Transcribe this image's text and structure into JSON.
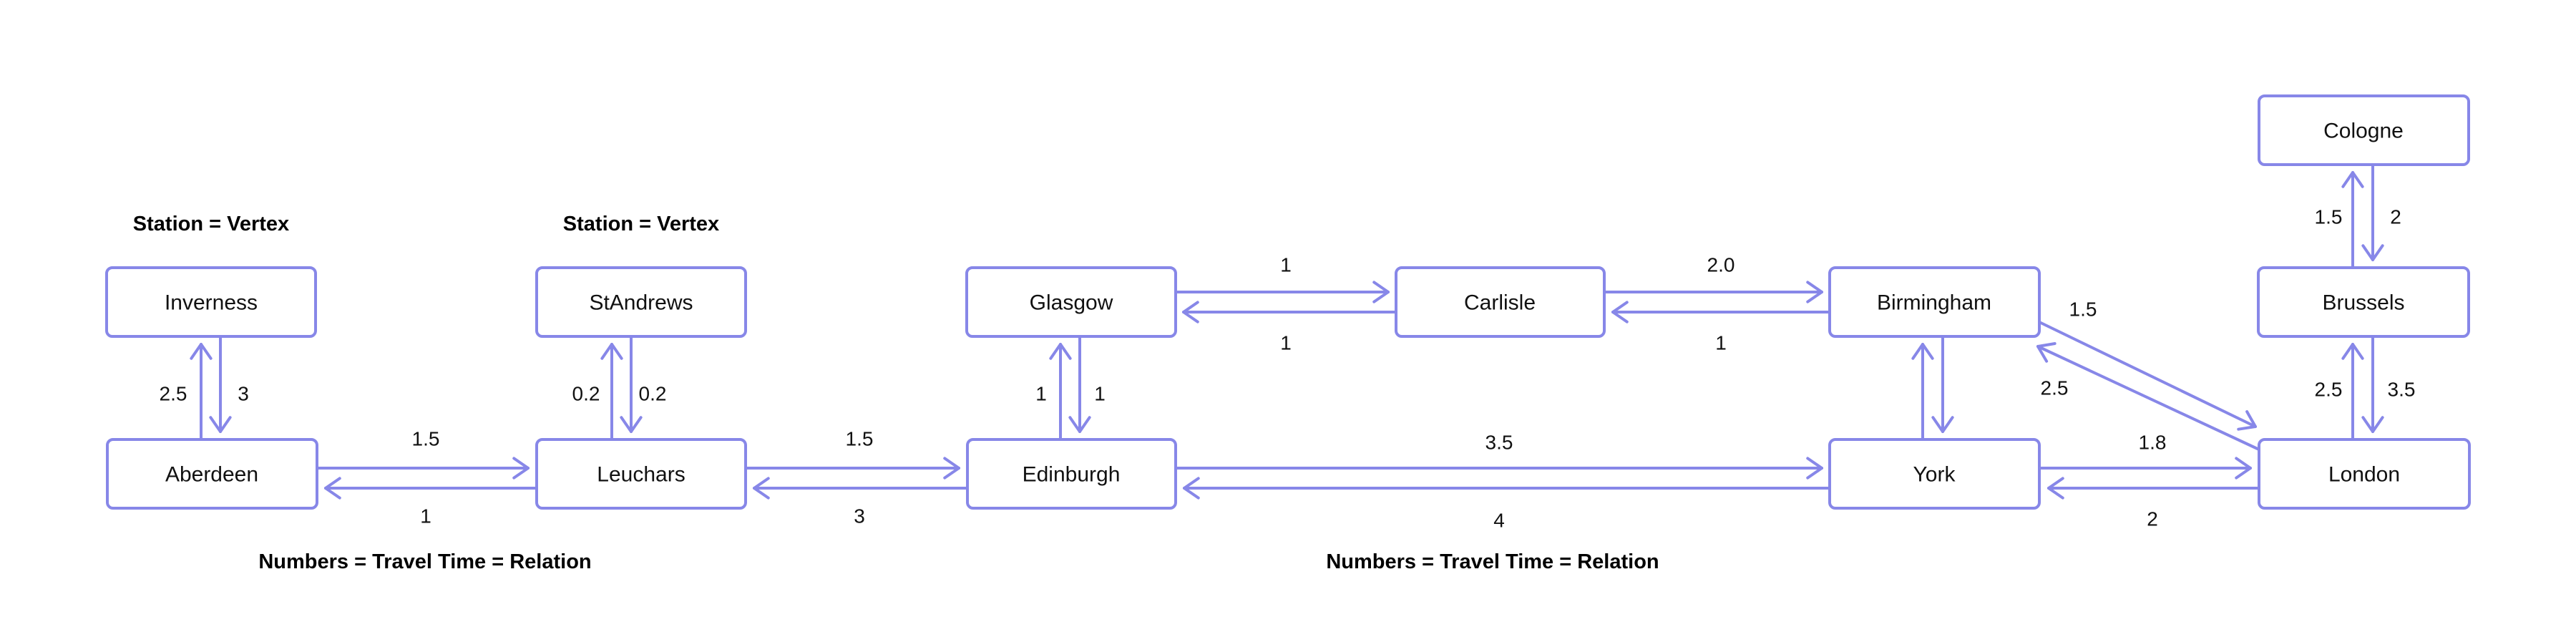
{
  "diagram": {
    "type": "directed-weighted-graph",
    "colors": {
      "edge": "#8787E8",
      "node_border": "#8787E8",
      "text": "#111111"
    },
    "annotations": [
      {
        "id": "vertex-note-1",
        "text": "Station = Vertex"
      },
      {
        "id": "vertex-note-2",
        "text": "Station = Vertex"
      },
      {
        "id": "relation-note-1",
        "text": "Numbers = Travel Time = Relation"
      },
      {
        "id": "relation-note-2",
        "text": "Numbers = Travel Time = Relation"
      }
    ],
    "nodes": [
      {
        "id": "inverness",
        "label": "Inverness"
      },
      {
        "id": "aberdeen",
        "label": "Aberdeen"
      },
      {
        "id": "standrews",
        "label": "StAndrews"
      },
      {
        "id": "leuchars",
        "label": "Leuchars"
      },
      {
        "id": "glasgow",
        "label": "Glasgow"
      },
      {
        "id": "edinburgh",
        "label": "Edinburgh"
      },
      {
        "id": "carlisle",
        "label": "Carlisle"
      },
      {
        "id": "birmingham",
        "label": "Birmingham"
      },
      {
        "id": "york",
        "label": "York"
      },
      {
        "id": "london",
        "label": "London"
      },
      {
        "id": "brussels",
        "label": "Brussels"
      },
      {
        "id": "cologne",
        "label": "Cologne"
      }
    ],
    "edges": [
      {
        "from": "aberdeen",
        "to": "inverness",
        "weight": "2.5"
      },
      {
        "from": "inverness",
        "to": "aberdeen",
        "weight": "3"
      },
      {
        "from": "leuchars",
        "to": "standrews",
        "weight": "0.2"
      },
      {
        "from": "standrews",
        "to": "leuchars",
        "weight": "0.2"
      },
      {
        "from": "aberdeen",
        "to": "leuchars",
        "weight": "1.5"
      },
      {
        "from": "leuchars",
        "to": "aberdeen",
        "weight": "1"
      },
      {
        "from": "leuchars",
        "to": "edinburgh",
        "weight": "1.5"
      },
      {
        "from": "edinburgh",
        "to": "leuchars",
        "weight": "3"
      },
      {
        "from": "edinburgh",
        "to": "glasgow",
        "weight": "1"
      },
      {
        "from": "glasgow",
        "to": "edinburgh",
        "weight": "1"
      },
      {
        "from": "glasgow",
        "to": "carlisle",
        "weight": "1"
      },
      {
        "from": "carlisle",
        "to": "glasgow",
        "weight": "1"
      },
      {
        "from": "carlisle",
        "to": "birmingham",
        "weight": "2.0"
      },
      {
        "from": "birmingham",
        "to": "carlisle",
        "weight": "1"
      },
      {
        "from": "edinburgh",
        "to": "york",
        "weight": "3.5"
      },
      {
        "from": "york",
        "to": "edinburgh",
        "weight": "4"
      },
      {
        "from": "york",
        "to": "birmingham",
        "weight": ""
      },
      {
        "from": "birmingham",
        "to": "york",
        "weight": ""
      },
      {
        "from": "birmingham",
        "to": "london",
        "weight": "1.5"
      },
      {
        "from": "london",
        "to": "birmingham",
        "weight": "2.5"
      },
      {
        "from": "york",
        "to": "london",
        "weight": "1.8"
      },
      {
        "from": "london",
        "to": "york",
        "weight": "2"
      },
      {
        "from": "london",
        "to": "brussels",
        "weight": "2.5"
      },
      {
        "from": "brussels",
        "to": "london",
        "weight": "3.5"
      },
      {
        "from": "brussels",
        "to": "cologne",
        "weight": "1.5"
      },
      {
        "from": "cologne",
        "to": "brussels",
        "weight": "2"
      }
    ]
  }
}
